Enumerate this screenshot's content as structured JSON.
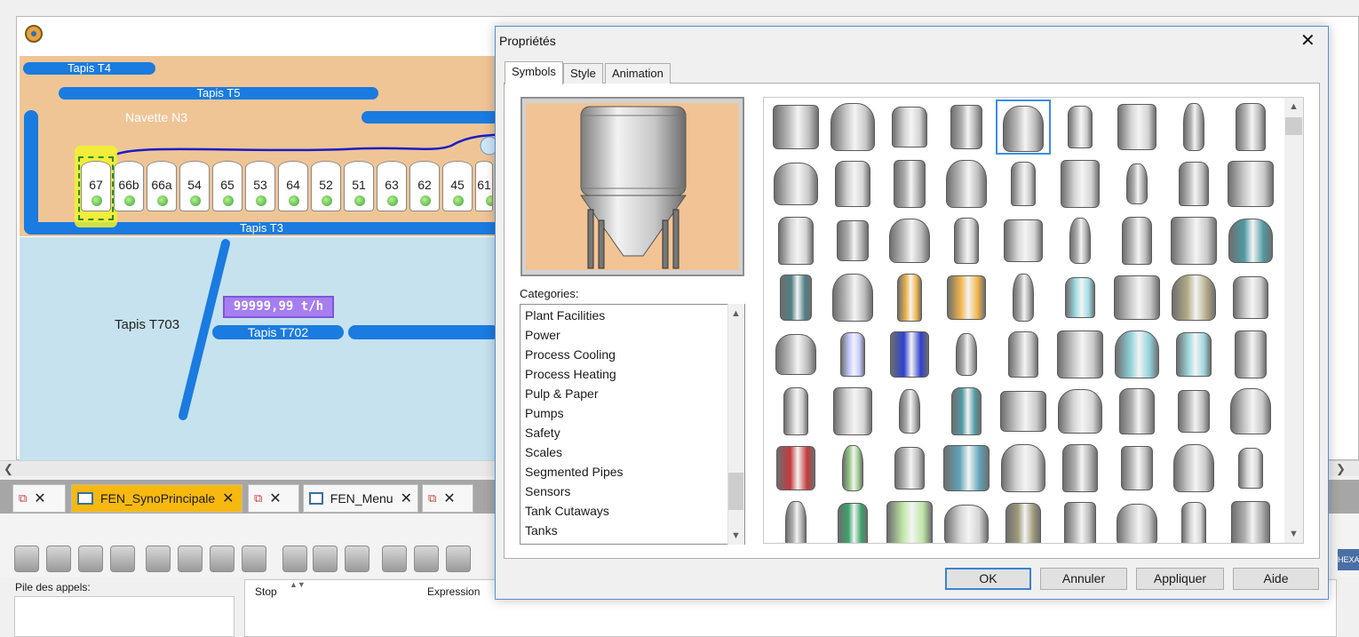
{
  "editor": {
    "belts": {
      "t4": "Tapis T4",
      "t5": "Tapis T5",
      "n3": "Navette N3",
      "t3": "Tapis T3",
      "t703": "Tapis T703",
      "t702": "Tapis T702"
    },
    "silos": [
      "67",
      "66b",
      "66a",
      "54",
      "65",
      "53",
      "64",
      "52",
      "51",
      "63",
      "62",
      "45",
      "61"
    ],
    "flow_value": "99999,99 t/h"
  },
  "tabs": [
    {
      "label": "FEN_SynoPrincipale",
      "active": true
    },
    {
      "label": "FEN_Menu",
      "active": false
    }
  ],
  "debug": {
    "call_stack_label": "Pile des appels:",
    "columns": {
      "stop": "Stop",
      "expression": "Expression"
    },
    "hexa_label": "HEXA"
  },
  "dialog": {
    "title": "Propriétés",
    "tabs": [
      "Symbols",
      "Style",
      "Animation"
    ],
    "categories_label": "Categories:",
    "categories": [
      "Plant Facilities",
      "Power",
      "Process Cooling",
      "Process Heating",
      "Pulp & Paper",
      "Pumps",
      "Safety",
      "Scales",
      "Segmented Pipes",
      "Sensors",
      "Tank Cutaways",
      "Tanks"
    ],
    "selected_category": "Tanks",
    "buttons": {
      "ok": "OK",
      "cancel": "Annuler",
      "apply": "Appliquer",
      "help": "Aide"
    }
  },
  "colors": {
    "belt_blue": "#1a7be0",
    "zone_orange": "#efc596",
    "zone_blue": "#c6e2ee",
    "active_tab": "#f7b90f",
    "flow_badge": "#a67ef0",
    "selection_border": "#3a8ee6"
  }
}
